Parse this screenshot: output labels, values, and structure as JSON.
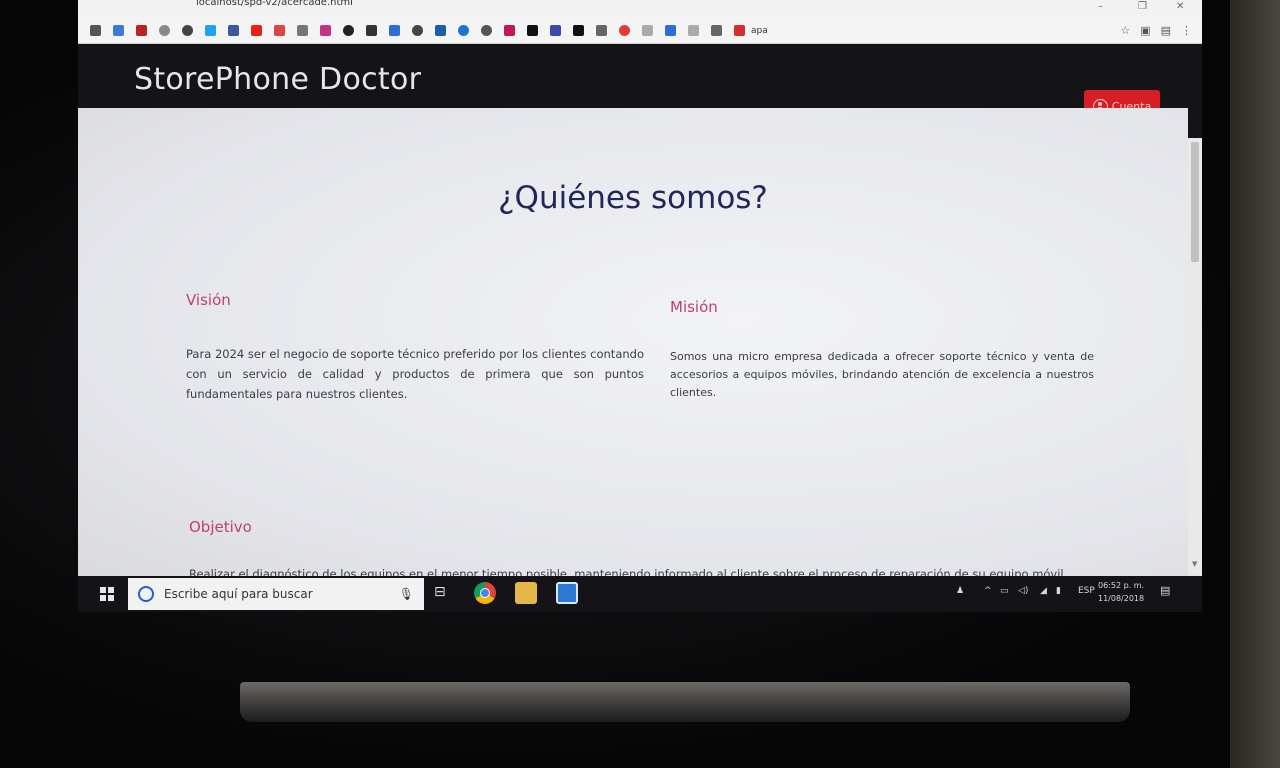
{
  "browser": {
    "url": "localhost/spd-v2/acercade.html",
    "bookmark_last_label": "apa",
    "window_controls": [
      "–",
      "❐",
      "✕"
    ],
    "toolbar_icons": [
      "star-icon",
      "extension-icon",
      "menu-icon"
    ]
  },
  "site": {
    "brand": "StorePhone Doctor",
    "account_label": "Cuenta"
  },
  "page": {
    "heading": "¿Quiénes somos?",
    "vision": {
      "title": "Visión",
      "text": "Para 2024 ser el negocio de soporte técnico preferido por los clientes contando con un servicio de calidad y productos de primera que son puntos fundamentales para nuestros clientes."
    },
    "mission": {
      "title": "Misión",
      "text": "Somos una micro empresa dedicada a ofrecer soporte técnico y venta de accesorios a equipos móviles, brindando atención de excelencia a nuestros clientes."
    },
    "objective": {
      "title": "Objetivo",
      "text": "Realizar el diagnóstico de los equipos en el menor tiempo posible, manteniendo informado al cliente sobre el proceso de reparación de su equipo móvil."
    }
  },
  "taskbar": {
    "search_placeholder": "Escribe aquí para buscar",
    "language": "ESP",
    "time": "06:52 p. m.",
    "date": "11/08/2018"
  },
  "colors": {
    "navbar": "#141417",
    "accent_red": "#d61e24",
    "section_title": "#c2406a",
    "heading": "#23265a"
  }
}
